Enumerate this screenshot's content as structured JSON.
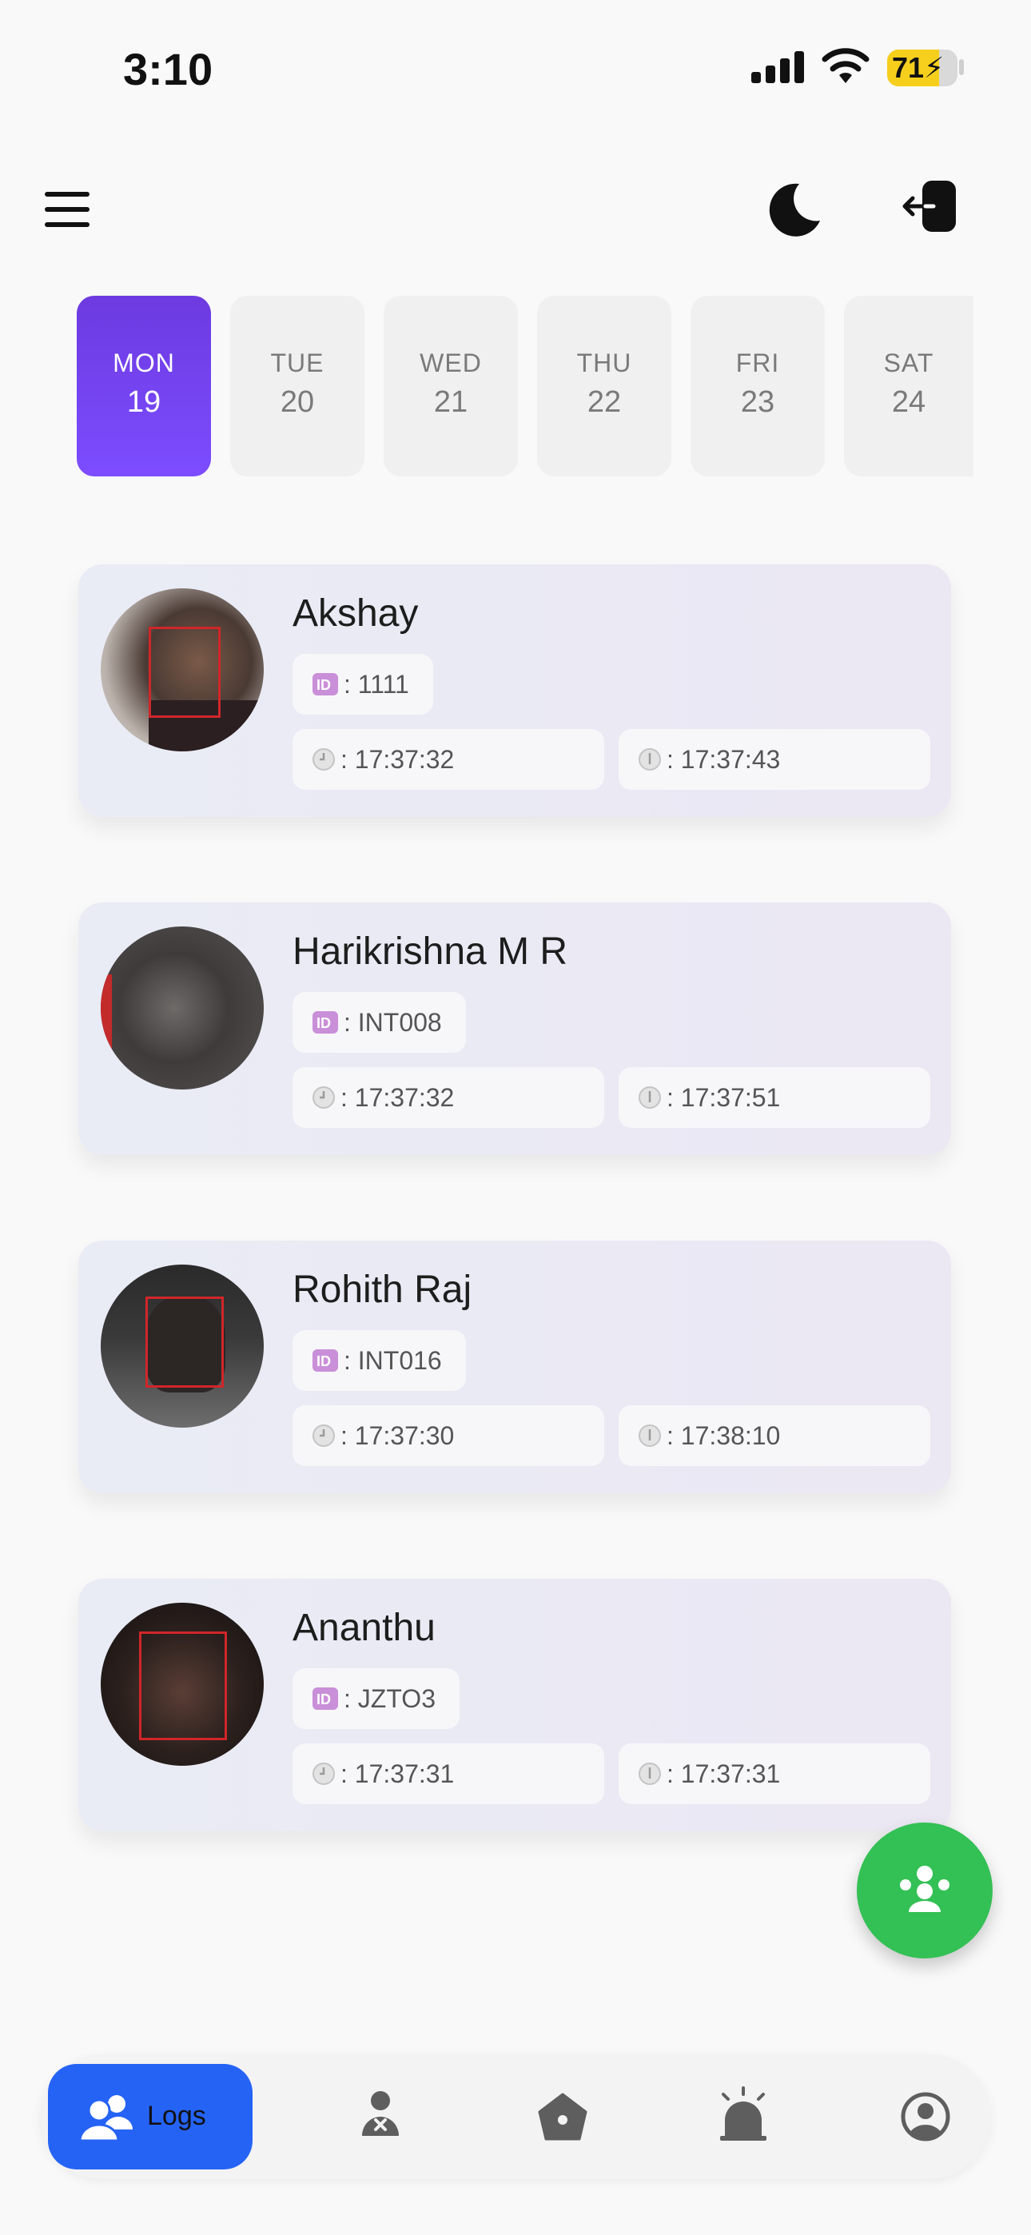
{
  "status_bar": {
    "time": "3:10",
    "battery": "71"
  },
  "days": [
    {
      "name": "MON",
      "num": "19",
      "active": true
    },
    {
      "name": "TUE",
      "num": "20",
      "active": false
    },
    {
      "name": "WED",
      "num": "21",
      "active": false
    },
    {
      "name": "THU",
      "num": "22",
      "active": false
    },
    {
      "name": "FRI",
      "num": "23",
      "active": false
    },
    {
      "name": "SAT",
      "num": "24",
      "active": false
    }
  ],
  "logs": [
    {
      "name": "Akshay",
      "id": ": 1111",
      "in_time": ": 17:37:32",
      "out_time": ": 17:37:43"
    },
    {
      "name": "Harikrishna M R",
      "id": ": INT008",
      "in_time": ": 17:37:32",
      "out_time": ": 17:37:51"
    },
    {
      "name": "Rohith Raj",
      "id": ": INT016",
      "in_time": ": 17:37:30",
      "out_time": ": 17:38:10"
    },
    {
      "name": "Ananthu",
      "id": ": JZTO3",
      "in_time": ": 17:37:31",
      "out_time": ": 17:37:31"
    }
  ],
  "bottom_nav": {
    "logs_label": "Logs",
    "active_color": "#2563f5"
  },
  "icons": {
    "menu": "menu-icon",
    "theme": "moon-icon",
    "logout": "logout-icon",
    "id": "id-card-icon",
    "in_time": "clock-icon",
    "out_time": "clock-out-icon",
    "fab": "face-scan-icon",
    "nav": [
      "users-icon",
      "user-remove-icon",
      "home-icon",
      "alarm-icon",
      "profile-icon"
    ]
  },
  "colors": {
    "accent_purple": "#7c4dff",
    "fab_green": "#33c055",
    "face_box": "#d0262a"
  }
}
